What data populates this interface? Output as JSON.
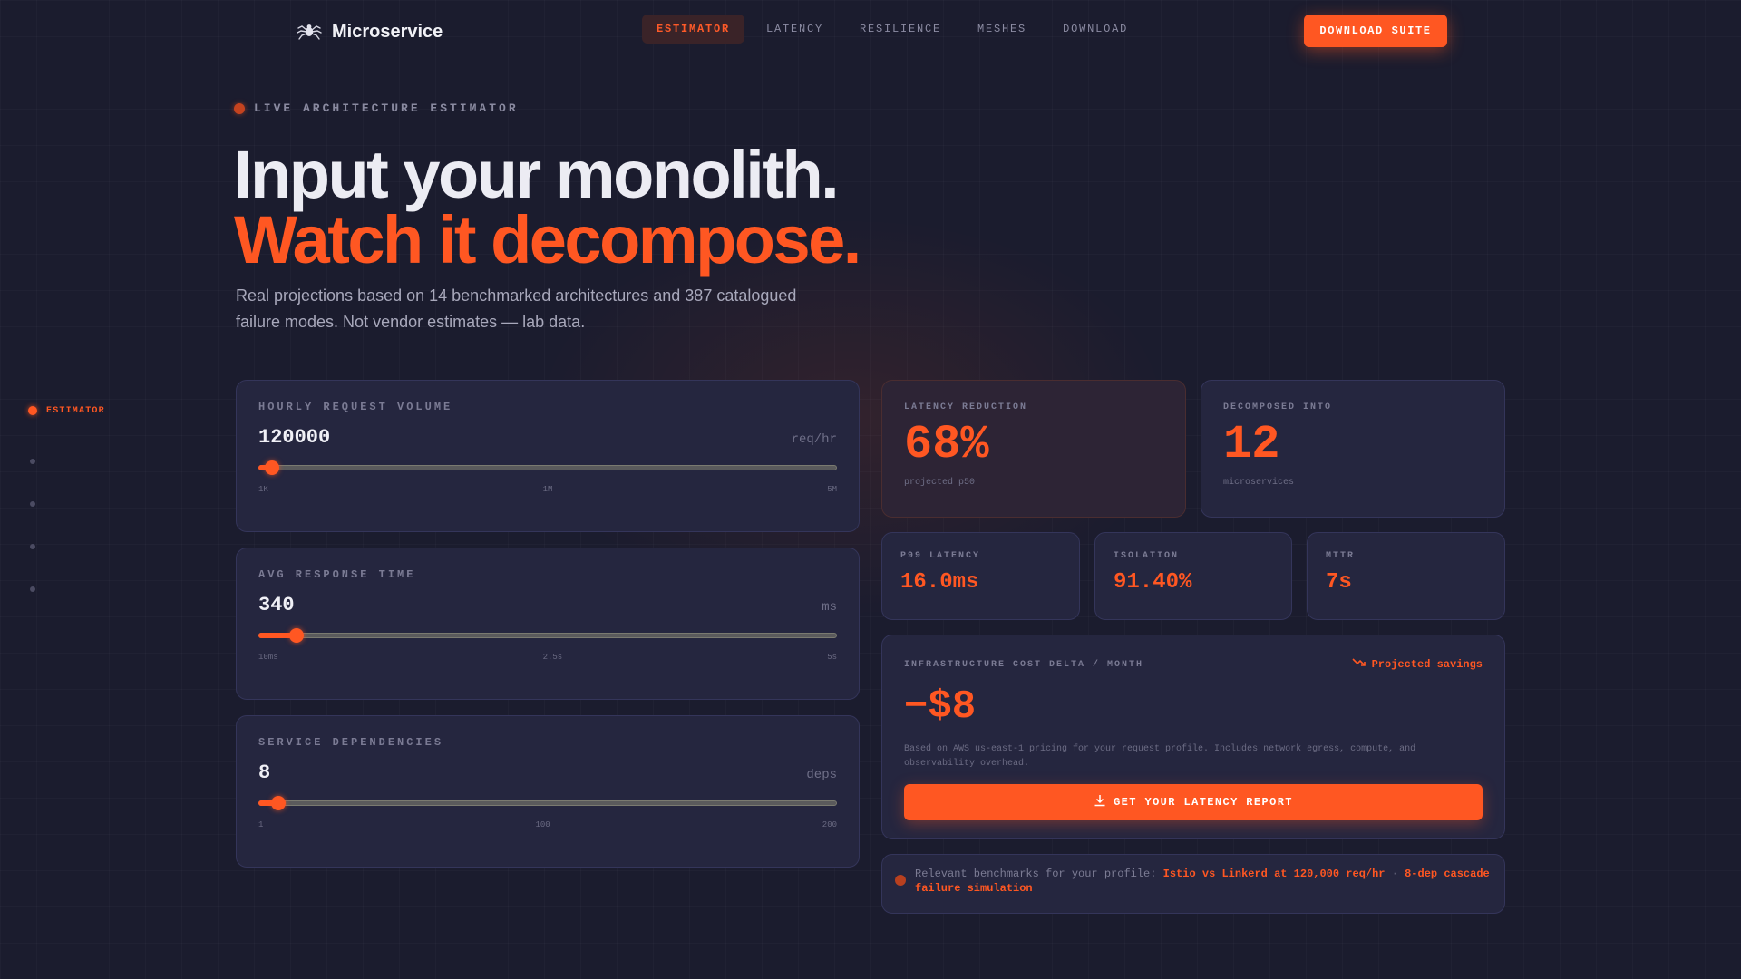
{
  "brand": {
    "name": "Microservice",
    "icon": "spider-logo-icon"
  },
  "nav": {
    "links": [
      "ESTIMATOR",
      "LATENCY",
      "RESILIENCE",
      "MESHES",
      "DOWNLOAD"
    ],
    "active": "ESTIMATOR",
    "cta": "DOWNLOAD SUITE"
  },
  "hero": {
    "eyebrow": "LIVE ARCHITECTURE ESTIMATOR",
    "headline_line1": "Input your monolith.",
    "headline_line2": "Watch it decompose.",
    "subtitle": "Real projections based on 14 benchmarked architectures and 387 catalogued failure modes. Not vendor estimates — lab data."
  },
  "sidenav": {
    "active_label": "ESTIMATOR"
  },
  "sliders": [
    {
      "label": "HOURLY REQUEST VOLUME",
      "value": "120000",
      "unit": "req/hr",
      "fill": 0.023,
      "ticks": [
        "1K",
        "1M",
        "5M"
      ]
    },
    {
      "label": "AVG RESPONSE TIME",
      "value": "340",
      "unit": "ms",
      "fill": 0.066,
      "ticks": [
        "10ms",
        "2.5s",
        "5s"
      ]
    },
    {
      "label": "SERVICE DEPENDENCIES",
      "value": "8",
      "unit": "deps",
      "fill": 0.035,
      "ticks": [
        "1",
        "100",
        "200"
      ]
    }
  ],
  "stats": {
    "latency_reduction": {
      "label": "LATENCY REDUCTION",
      "value": "68%",
      "note": "projected p50"
    },
    "decomposed": {
      "label": "DECOMPOSED INTO",
      "value": "12",
      "note": "microservices"
    },
    "p99": {
      "label": "P99 LATENCY",
      "value": "16.0ms"
    },
    "isolation": {
      "label": "ISOLATION",
      "value": "91.40%"
    },
    "mttr": {
      "label": "MTTR",
      "value": "7s"
    }
  },
  "cost": {
    "label": "INFRASTRUCTURE COST DELTA / MONTH",
    "badge": "Projected savings",
    "value": "−$8",
    "note": "Based on AWS us-east-1 pricing for your request profile. Includes network egress, compute, and observability overhead.",
    "button": "GET YOUR LATENCY REPORT"
  },
  "benchmarks": {
    "prefix": "Relevant benchmarks for your profile:",
    "link1": "Istio vs Linkerd at 120,000 req/hr",
    "separator": "·",
    "link2": "8-dep cascade failure simulation"
  },
  "colors": {
    "accent": "#ff5722",
    "background": "#1b1c2e",
    "card": "#25263f"
  }
}
